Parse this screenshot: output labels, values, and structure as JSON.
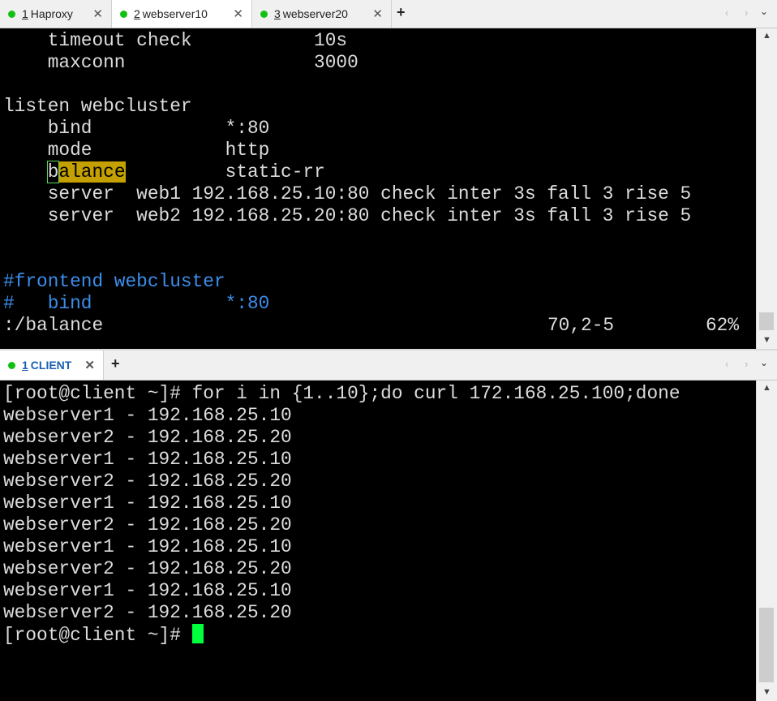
{
  "top_tabs": [
    {
      "num": "1",
      "label": "Haproxy"
    },
    {
      "num": "2",
      "label": "webserver10"
    },
    {
      "num": "3",
      "label": "webserver20"
    }
  ],
  "bottom_tabs": [
    {
      "num": "1",
      "label": "CLIENT"
    }
  ],
  "icons": {
    "add": "+",
    "close": "✕",
    "nav": "‹ ›",
    "chevron": "⌄"
  },
  "top_terminal": {
    "l1": "    timeout check           10s",
    "l2": "    maxconn                 3000",
    "l3": "",
    "l4": "listen webcluster",
    "l5": "    bind            *:80",
    "l6": "    mode            http",
    "l7_b": "b",
    "l7_rest": "alance",
    "l7_after": "         static-rr",
    "l8": "    server  web1 192.168.25.10:80 check inter 3s fall 3 rise 5",
    "l9": "    server  web2 192.168.25.20:80 check inter 3s fall 3 rise 5",
    "l12": "#frontend webcluster",
    "l13": "#   bind            *:80",
    "status_cmd": ":/balance",
    "status_pos": "70,2-5",
    "status_pct": "62%"
  },
  "bottom_terminal": {
    "lines": [
      "[root@client ~]# for i in {1..10};do curl 172.168.25.100;done",
      "webserver1 - 192.168.25.10",
      "webserver2 - 192.168.25.20",
      "webserver1 - 192.168.25.10",
      "webserver2 - 192.168.25.20",
      "webserver1 - 192.168.25.10",
      "webserver2 - 192.168.25.20",
      "webserver1 - 192.168.25.10",
      "webserver2 - 192.168.25.20",
      "webserver1 - 192.168.25.10",
      "webserver2 - 192.168.25.20"
    ],
    "prompt": "[root@client ~]# "
  }
}
